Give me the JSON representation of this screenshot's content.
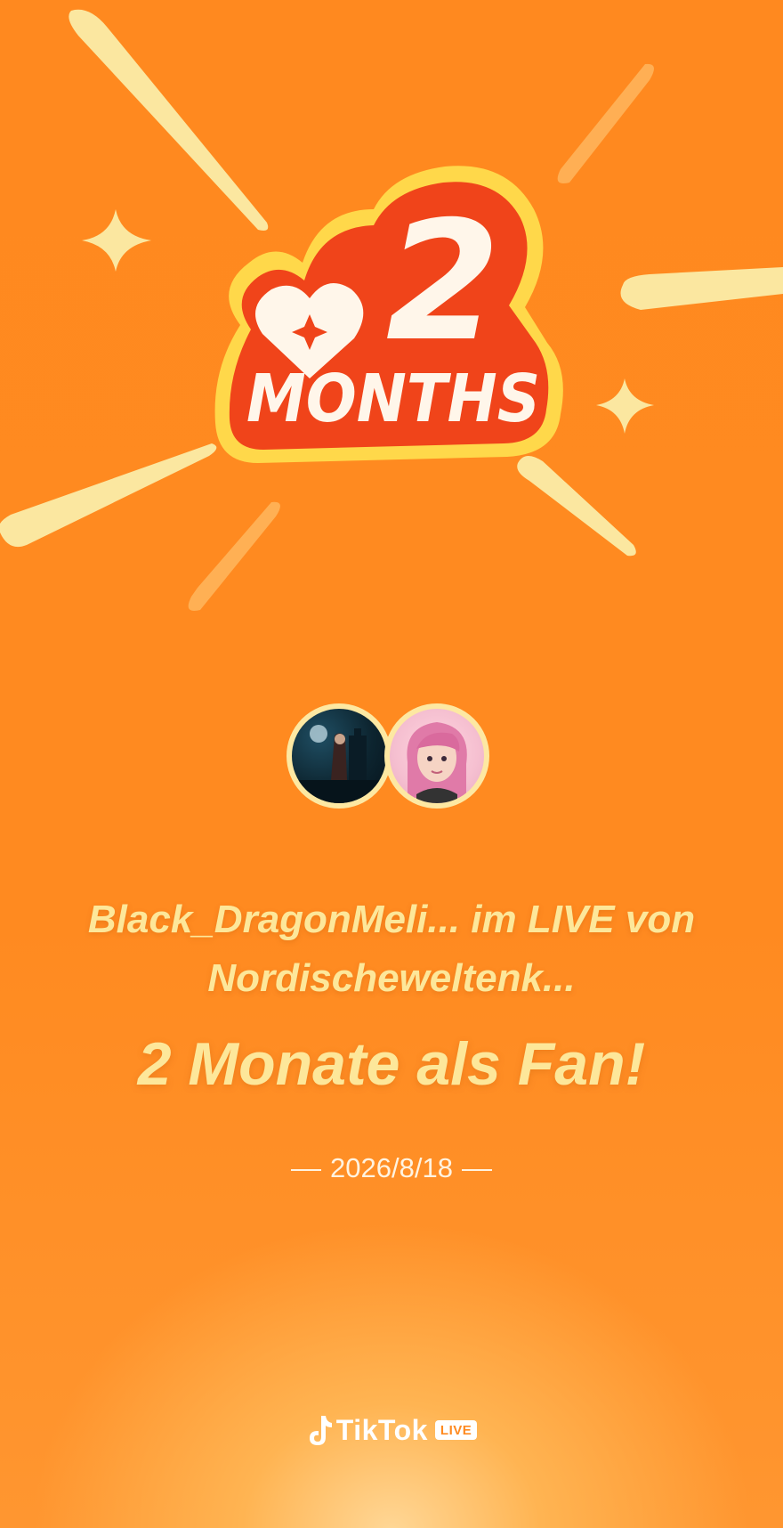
{
  "badge": {
    "number": "2",
    "word": "MONTHS"
  },
  "users": {
    "fan_avatar_icon": "fan-avatar",
    "host_avatar_icon": "host-avatar"
  },
  "message": {
    "line1": "Black_DragonMeli... im LIVE von",
    "line2": "Nordischeweltenk...",
    "title": "2 Monate als Fan!",
    "date": "2026/8/18"
  },
  "brand": {
    "name": "TikTok",
    "live_label": "LIVE",
    "logo_icon": "tiktok-note-icon"
  },
  "colors": {
    "background": "#ff8a20",
    "accent_text": "#fde79a",
    "badge_red": "#f0441a",
    "badge_outline": "#ffd84a"
  }
}
